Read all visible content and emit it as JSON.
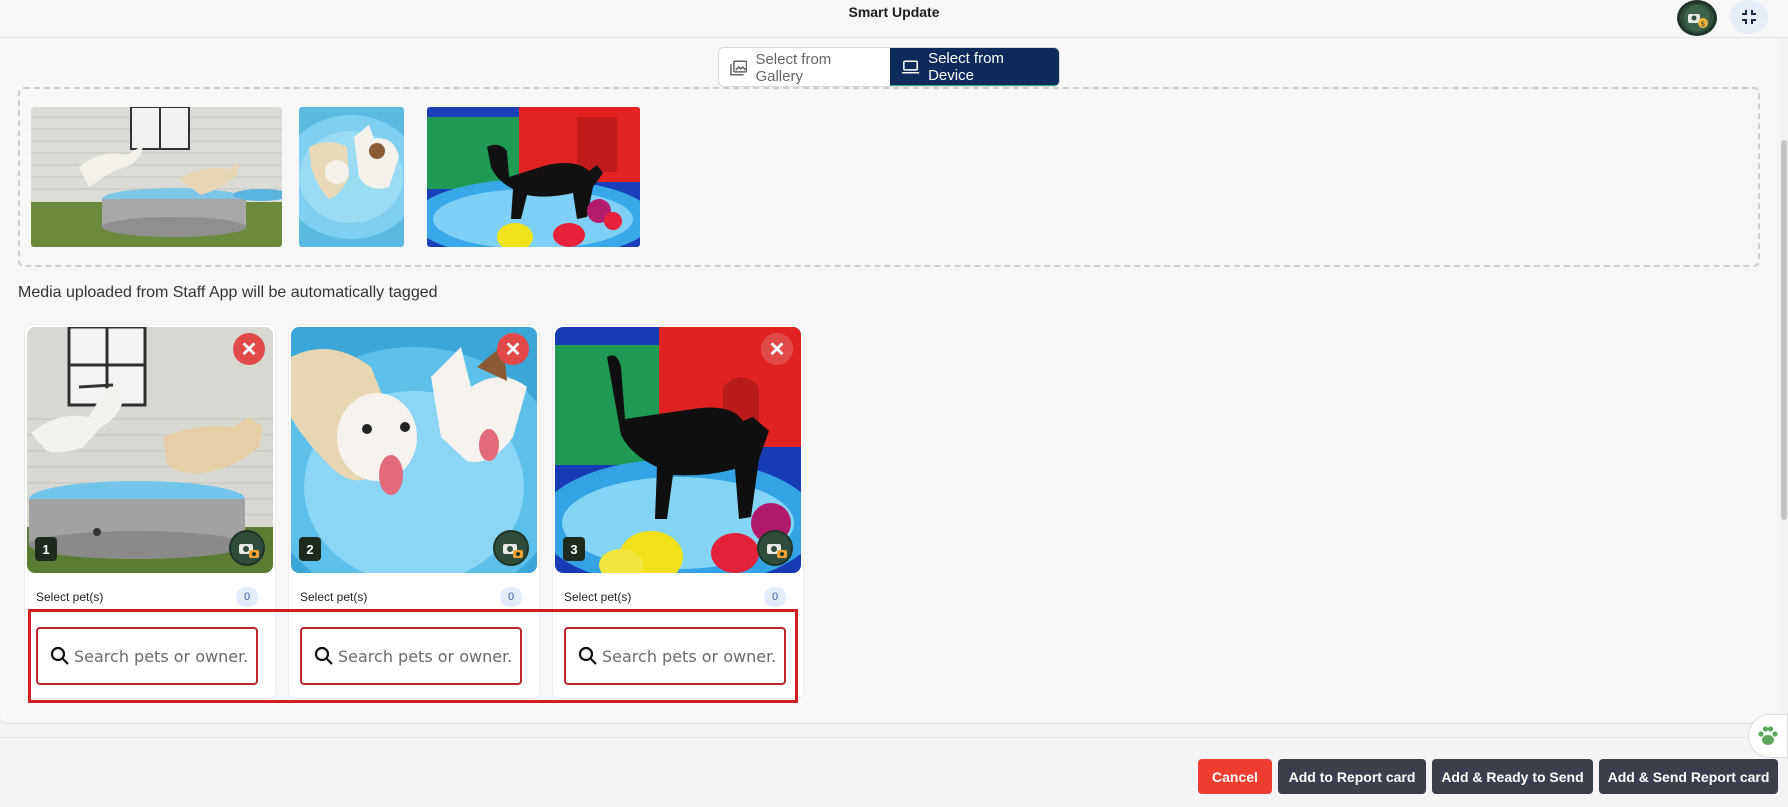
{
  "header": {
    "title": "Smart Update"
  },
  "tabs": {
    "gallery_label": "Select from Gallery",
    "device_label": "Select from Device",
    "active": "Select from Device"
  },
  "upload_note": "Media uploaded from Staff App will be automatically tagged",
  "cards": [
    {
      "number": "1",
      "select_label": "Select pet(s)",
      "count": "0",
      "search_placeholder": "Search pets or owner..."
    },
    {
      "number": "2",
      "select_label": "Select pet(s)",
      "count": "0",
      "search_placeholder": "Search pets or owner..."
    },
    {
      "number": "3",
      "select_label": "Select pet(s)",
      "count": "0",
      "search_placeholder": "Search pets or owner..."
    }
  ],
  "footer": {
    "cancel_label": "Cancel",
    "add_report_label": "Add to Report card",
    "add_ready_label": "Add & Ready to Send",
    "add_send_label": "Add & Send Report card"
  },
  "colors": {
    "accent_navy": "#0d2a5a",
    "accent_green": "#2bb673",
    "danger": "#ef3d30",
    "dark_button": "#3a3f4b"
  },
  "icons": {
    "avatar": "staff-avatar-icon",
    "collapse": "collapse-icon",
    "gallery": "image-gallery-icon",
    "device": "laptop-icon",
    "remove": "close-icon",
    "camera": "camera-badge-icon",
    "search": "search-icon",
    "assistant": "paw-icon"
  }
}
